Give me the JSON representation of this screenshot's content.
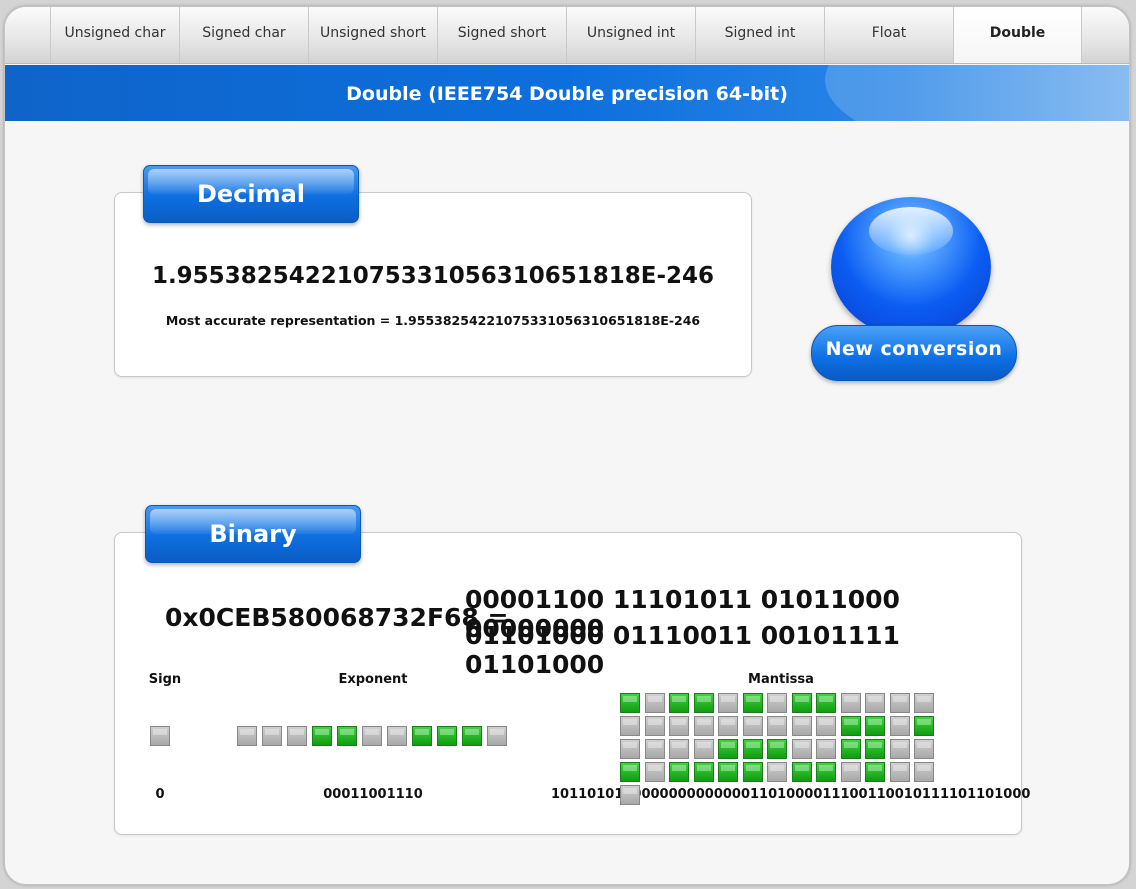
{
  "tabs": [
    {
      "label": "Unsigned char",
      "active": false
    },
    {
      "label": "Signed char",
      "active": false
    },
    {
      "label": "Unsigned short",
      "active": false
    },
    {
      "label": "Signed short",
      "active": false
    },
    {
      "label": "Unsigned int",
      "active": false
    },
    {
      "label": "Signed int",
      "active": false
    },
    {
      "label": "Float",
      "active": false
    },
    {
      "label": "Double",
      "active": true
    }
  ],
  "header": {
    "title": "Double (IEEE754 Double precision 64-bit)"
  },
  "decimal": {
    "heading": "Decimal",
    "value": "1.95538254221075331056310651818E-246",
    "accurate": "Most accurate representation = 1.95538254221075331056310651818E-246"
  },
  "new_conversion": {
    "label": "New conversion"
  },
  "binary": {
    "heading": "Binary",
    "hex": "0x0CEB580068732F68 =",
    "line1": "00001100 11101011 01011000 00000000",
    "line2": "01101000 01110011 00101111 01101000",
    "sign": {
      "label": "Sign",
      "bits": "0"
    },
    "exponent": {
      "label": "Exponent",
      "bits": "00011001110"
    },
    "mantissa": {
      "label": "Mantissa",
      "bits": "1011010110000000000000110100001110011001011110110100​0"
    }
  },
  "colors": {
    "accent": "#0d6fe0",
    "bit_on": "#22b022",
    "bit_off": "#b8b8b8"
  }
}
